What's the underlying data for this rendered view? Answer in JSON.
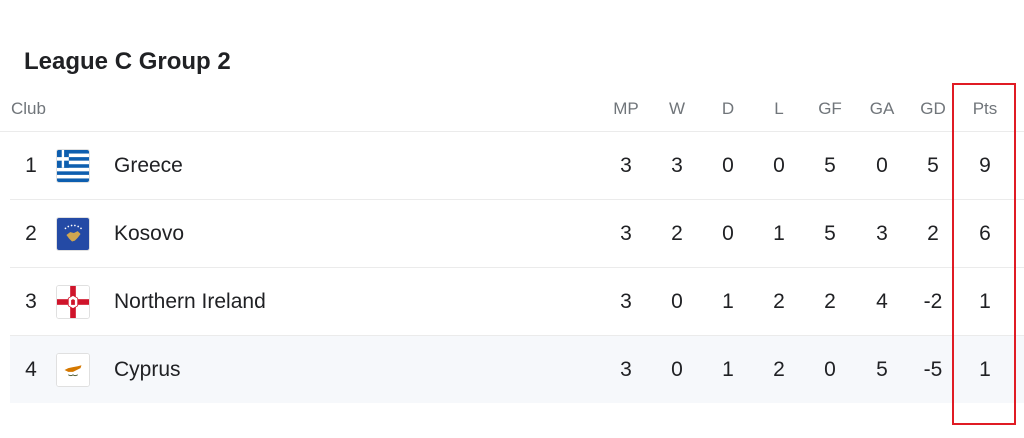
{
  "title": "League C Group 2",
  "columns": {
    "club": "Club",
    "mp": "MP",
    "w": "W",
    "d": "D",
    "l": "L",
    "gf": "GF",
    "ga": "GA",
    "gd": "GD",
    "pts": "Pts"
  },
  "rows": [
    {
      "rank": "1",
      "team": "Greece",
      "flag_icon": "greece-flag-icon",
      "mp": "3",
      "w": "3",
      "d": "0",
      "l": "0",
      "gf": "5",
      "ga": "0",
      "gd": "5",
      "pts": "9"
    },
    {
      "rank": "2",
      "team": "Kosovo",
      "flag_icon": "kosovo-flag-icon",
      "mp": "3",
      "w": "2",
      "d": "0",
      "l": "1",
      "gf": "5",
      "ga": "3",
      "gd": "2",
      "pts": "6"
    },
    {
      "rank": "3",
      "team": "Northern Ireland",
      "flag_icon": "northern-ireland-flag-icon",
      "mp": "3",
      "w": "0",
      "d": "1",
      "l": "2",
      "gf": "2",
      "ga": "4",
      "gd": "-2",
      "pts": "1"
    },
    {
      "rank": "4",
      "team": "Cyprus",
      "flag_icon": "cyprus-flag-icon",
      "mp": "3",
      "w": "0",
      "d": "1",
      "l": "2",
      "gf": "0",
      "ga": "5",
      "gd": "-5",
      "pts": "1"
    }
  ],
  "colors": {
    "highlight_box": "#e01b24",
    "greece_blue": "#0d5eaf",
    "kosovo_blue": "#244aa5",
    "kosovo_gold": "#d0a650",
    "cyprus_copper": "#d57800",
    "ni_red": "#cf142b"
  }
}
